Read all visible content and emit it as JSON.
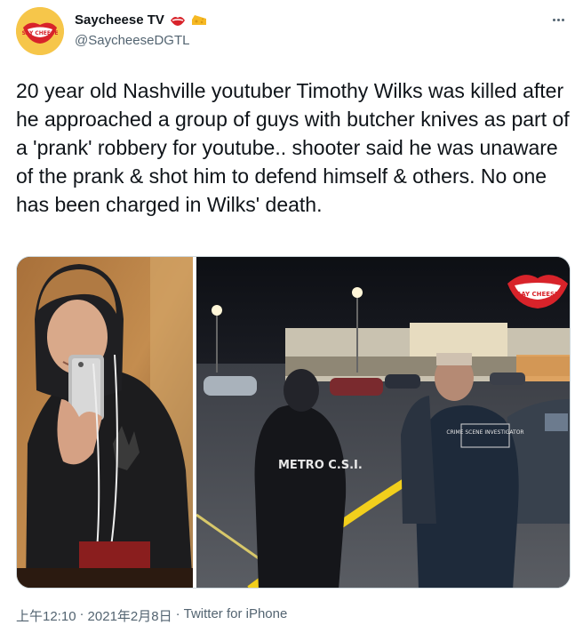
{
  "account": {
    "display_name": "Saycheese TV",
    "handle": "@SaycheeseDGTL",
    "avatar_text": "SAY CHEESE",
    "badge_emojis": [
      "lips-emoji",
      "cheese-emoji"
    ]
  },
  "tweet": {
    "text": "20 year old Nashville youtuber Timothy Wilks was killed after he approached a group of guys with butcher knives as part of a 'prank' robbery for youtube.. shooter said he was unaware of the prank & shot him to defend himself & others. No one has been charged in Wilks' death.",
    "time": "上午12:10",
    "separator": "·",
    "date": "2021年2月8日",
    "source": "Twitter for iPhone"
  },
  "media": {
    "left_photo": "selfie-photo",
    "right_photo": "crime-scene-photo",
    "watermark_text": "SAY CHEESE",
    "jacket_text_left": "METRO C.S.I.",
    "jacket_text_right": "CRIME SCENE INVESTIGATOR"
  },
  "colors": {
    "text_primary": "#0f1419",
    "text_secondary": "#536471",
    "border": "#cfd9de",
    "avatar_bg": "#f6c64a",
    "lips_red": "#d8232a"
  }
}
